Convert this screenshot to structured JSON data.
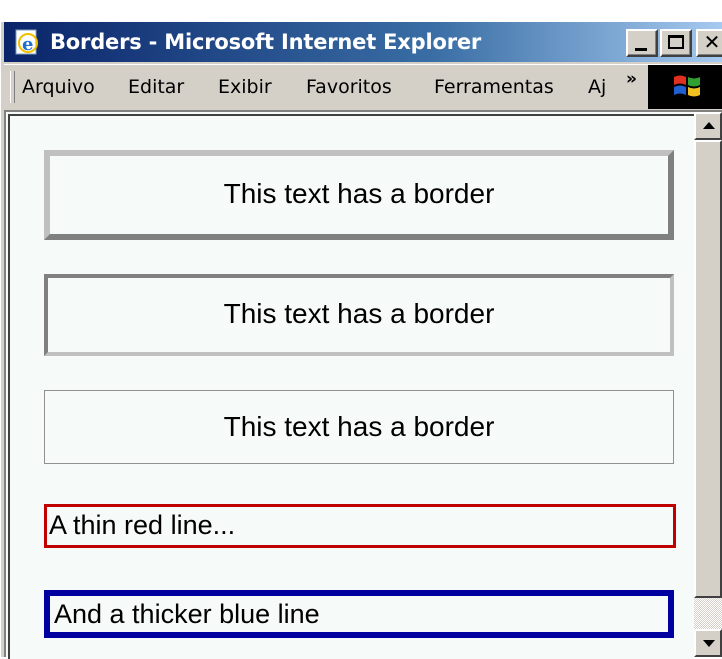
{
  "window": {
    "title": "Borders - Microsoft Internet Explorer",
    "controls": {
      "minimize": "_",
      "maximize": "□",
      "close": "✕"
    }
  },
  "menu": {
    "items": [
      {
        "label": "Arquivo"
      },
      {
        "label": "Editar"
      },
      {
        "label": "Exibir"
      },
      {
        "label": "Favoritos"
      },
      {
        "label": "Ferramentas"
      },
      {
        "label": "Aj"
      }
    ],
    "overflow": "»"
  },
  "content": {
    "boxes": [
      {
        "text": "This text has a border",
        "style": "outset thick grey"
      },
      {
        "text": "This text has a border",
        "style": "inset grey"
      },
      {
        "text": "This text has a border",
        "style": "thin grey"
      },
      {
        "text": "A thin red line...",
        "color": "#c00000"
      },
      {
        "text": "And a thicker blue line",
        "color": "#0000a0"
      }
    ]
  },
  "icons": {
    "app": "ie-page-icon",
    "brand": "windows-flag-icon",
    "scroll_up": "arrow-up-icon",
    "scroll_down": "arrow-down-icon"
  },
  "colors": {
    "titlebar_start": "#0a246a",
    "titlebar_end": "#a6caf0",
    "chrome": "#d4d0c8",
    "page_background": "#f6faf8"
  }
}
